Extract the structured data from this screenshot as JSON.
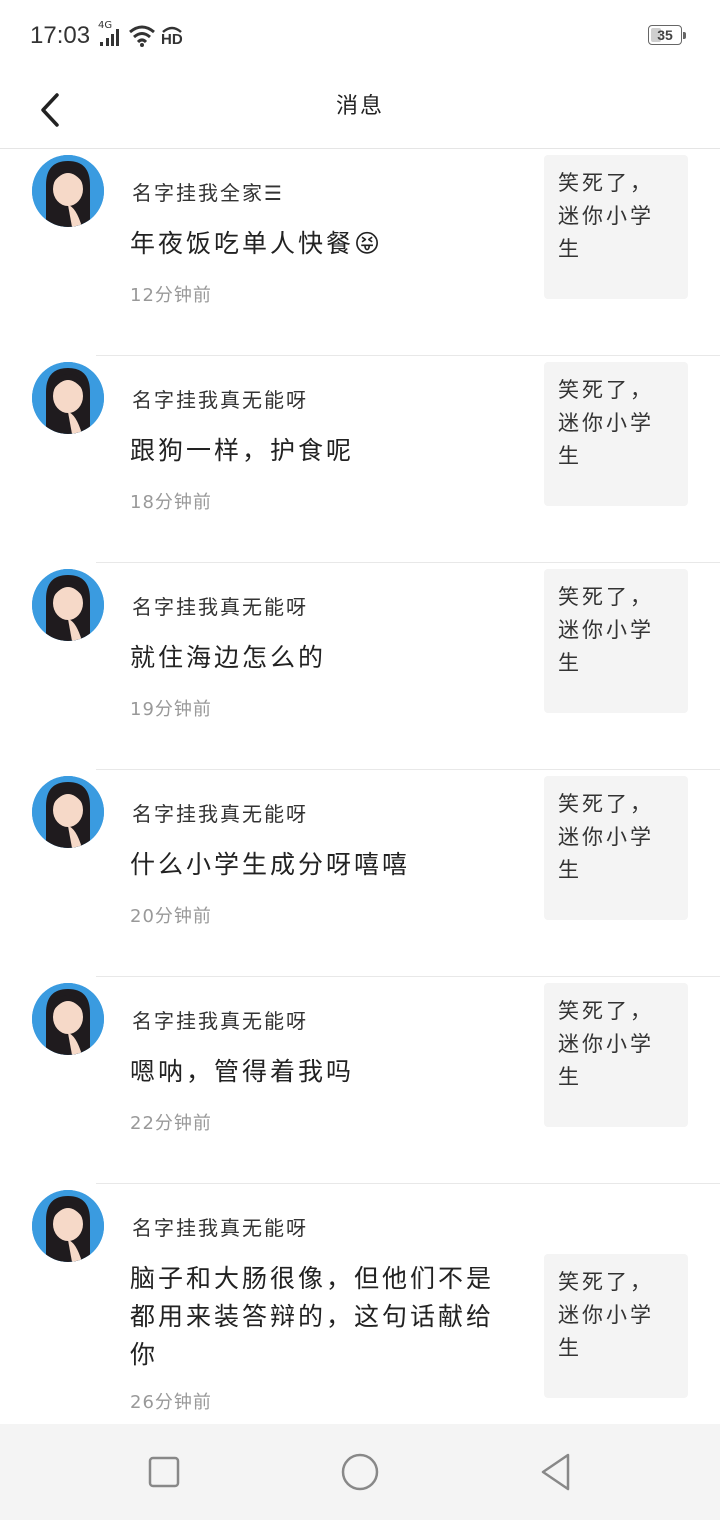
{
  "status_bar": {
    "time": "17:03",
    "network": "4G",
    "hd_label": "HD",
    "battery": "35"
  },
  "header": {
    "title": "消息",
    "back_icon": "chevron-left-icon"
  },
  "messages": [
    {
      "username": "名字挂我全家☰",
      "text": "年夜饭吃单人快餐😝",
      "time": "12分钟前",
      "quote_lines": [
        "笑死了，",
        "迷你小学",
        "生"
      ]
    },
    {
      "username": "名字挂我真无能呀",
      "text": "跟狗一样，护食呢",
      "time": "18分钟前",
      "quote_lines": [
        "笑死了，",
        "迷你小学",
        "生"
      ]
    },
    {
      "username": "名字挂我真无能呀",
      "text": "就住海边怎么的",
      "time": "19分钟前",
      "quote_lines": [
        "笑死了，",
        "迷你小学",
        "生"
      ]
    },
    {
      "username": "名字挂我真无能呀",
      "text": "什么小学生成分呀嘻嘻",
      "time": "20分钟前",
      "quote_lines": [
        "笑死了，",
        "迷你小学",
        "生"
      ]
    },
    {
      "username": "名字挂我真无能呀",
      "text": "嗯呐，管得着我吗",
      "time": "22分钟前",
      "quote_lines": [
        "笑死了，",
        "迷你小学",
        "生"
      ]
    },
    {
      "username": "名字挂我真无能呀",
      "text": "脑子和大肠很像，但他们不是都用来装答辩的，这句话献给你",
      "time": "26分钟前",
      "quote_lines": [
        "笑死了，",
        "迷你小学",
        "生"
      ]
    }
  ],
  "nav_bar": {
    "icons": [
      "square-icon",
      "circle-home-icon",
      "triangle-back-icon"
    ]
  },
  "colors": {
    "background": "#ffffff",
    "quote_bg": "#f4f4f4",
    "nav_bg": "#f4f4f4",
    "timestamp": "#999999",
    "avatar_bg": "#3a9be0"
  }
}
